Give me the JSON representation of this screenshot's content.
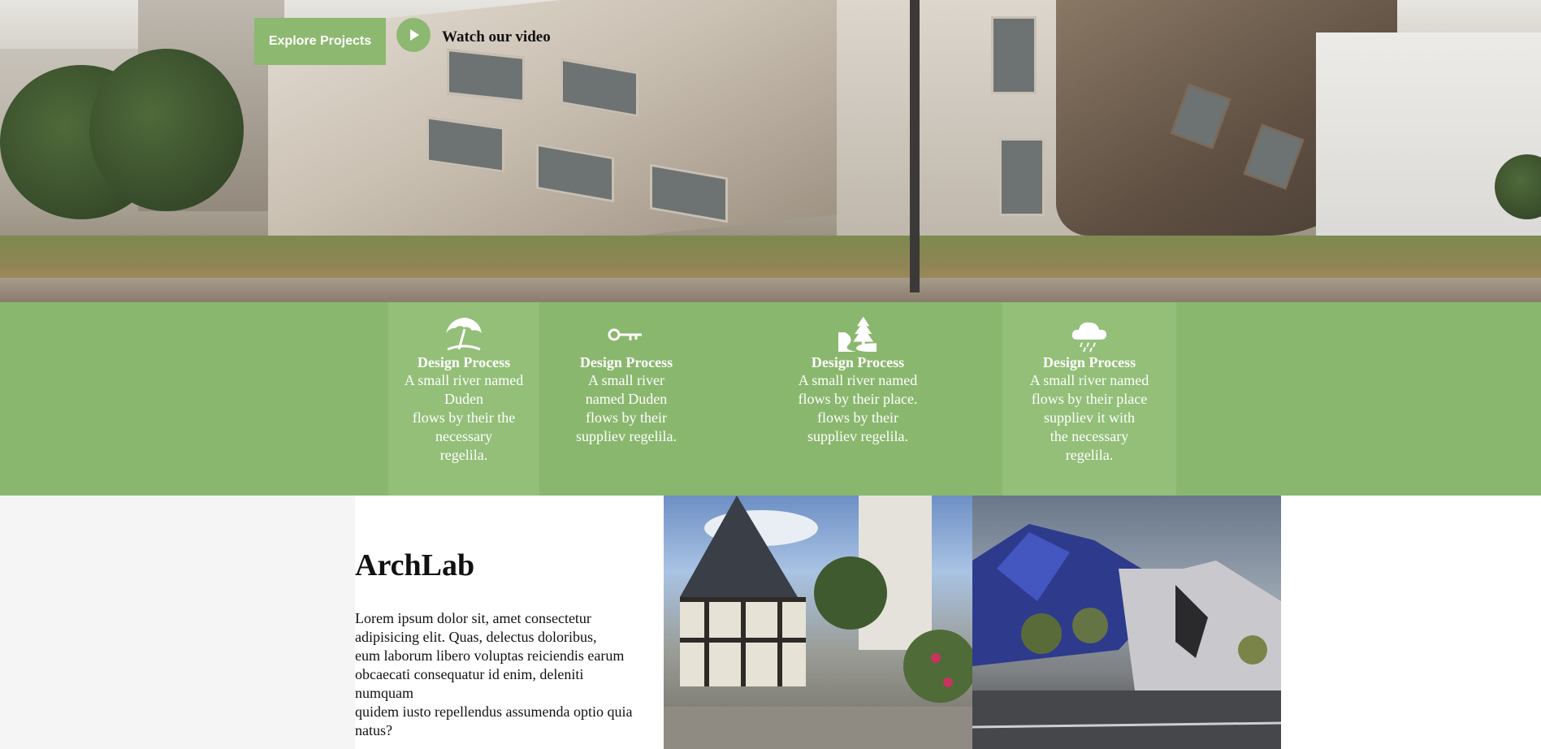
{
  "hero": {
    "explore_label": "Explore Projects",
    "watch_label": "Watch our video"
  },
  "services": [
    {
      "icon": "umbrella-icon",
      "title": "Design Process",
      "lines": [
        "A small river named",
        "Duden",
        "flows by their the",
        "necessary",
        "regelila."
      ]
    },
    {
      "icon": "key-icon",
      "title": "Design Process",
      "lines": [
        "A small river",
        "named Duden",
        "flows by their",
        "suppliev regelila."
      ]
    },
    {
      "icon": "landscape-icon",
      "title": "Design Process",
      "lines": [
        "A small river named",
        "flows by their place.",
        "flows by their",
        "suppliev regelila."
      ]
    },
    {
      "icon": "cloud-rain-icon",
      "title": "Design Process",
      "lines": [
        "A small river named",
        "flows by their place",
        "suppliev it with",
        "the necessary",
        "regelila."
      ]
    }
  ],
  "about": {
    "title": "ArchLab",
    "lines": [
      "Lorem ipsum dolor sit, amet consectetur",
      "adipisicing elit. Quas, delectus doloribus,",
      "eum laborum libero voluptas reiciendis earum",
      "obcaecati consequatur id enim, deleniti",
      "numquam",
      "quidem iusto repellendus assumenda optio quia",
      "natus?"
    ]
  },
  "colors": {
    "accent": "#8ab76e"
  }
}
